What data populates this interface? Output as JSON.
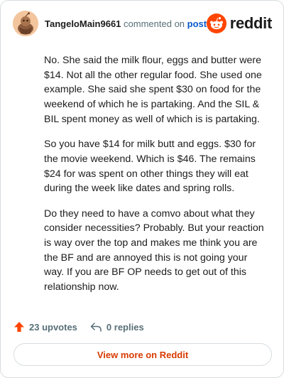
{
  "comment": {
    "author": "TangeloMain9661",
    "action_text": "commented on",
    "post_link": "post",
    "paragraphs": [
      "No. She said the milk flour, eggs and butter were $14. Not all the other regular food. She used one example. She said she spent $30 on food for the weekend of which he is partaking. And the SIL & BIL spent money as well of which is is partaking.",
      "So you have $14 for milk butt and eggs. $30 for the movie weekend. Which is $46. The remains $24 for was spent on other things they will eat during the week like dates and spring rolls.",
      "Do they need to have a comvo about what they consider necessities? Probably. But your reaction is way over the top and makes me think you are the BF and are annoyed this is not going your way. If you are BF OP needs to get out of this relationship now."
    ],
    "upvotes": "23 upvotes",
    "replies": "0 replies"
  },
  "brand": {
    "name": "reddit",
    "color": "#ff4500"
  },
  "cta": {
    "label": "View more on Reddit"
  },
  "icons": {
    "avatar": "snoo-avatar-icon",
    "upvote": "upvote-arrow-icon",
    "reply": "reply-arrow-icon"
  }
}
